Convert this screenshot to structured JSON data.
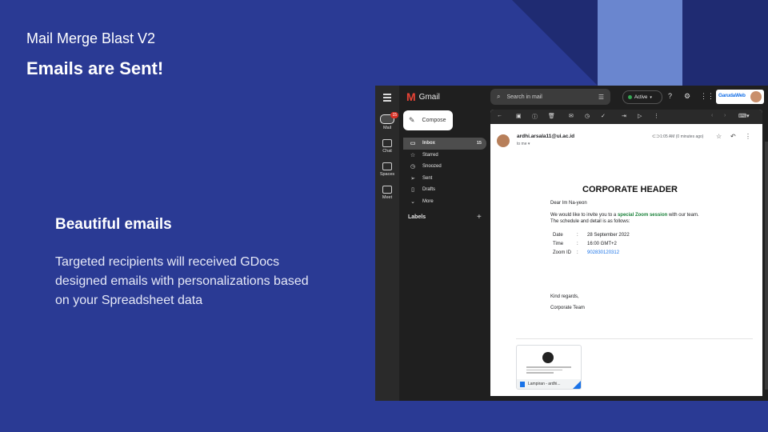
{
  "slide": {
    "subtitle": "Mail Merge Blast V2",
    "title": "Emails are Sent!",
    "feature_title": "Beautiful emails",
    "feature_desc": "Targeted recipients will received GDocs designed emails with personalizations based on your Spreadsheet data",
    "colors": {
      "background": "#2a3a94",
      "accent_light": "#6a86cf",
      "accent_dark": "#1f2b72"
    }
  },
  "gmail": {
    "logo_text": "Gmail",
    "search_placeholder": "Search in mail",
    "status": "Active",
    "brand_text": "GarudaWeb",
    "rail": [
      {
        "label": "Mail",
        "badge": "15",
        "icon": "mail-icon"
      },
      {
        "label": "Chat",
        "icon": "chat-icon"
      },
      {
        "label": "Spaces",
        "icon": "spaces-icon"
      },
      {
        "label": "Meet",
        "icon": "meet-icon"
      }
    ],
    "compose_label": "Compose",
    "nav": [
      {
        "label": "Inbox",
        "count": "15",
        "icon": "inbox-icon"
      },
      {
        "label": "Starred",
        "count": "",
        "icon": "star-icon"
      },
      {
        "label": "Snoozed",
        "count": "",
        "icon": "clock-icon"
      },
      {
        "label": "Sent",
        "count": "",
        "icon": "send-icon"
      },
      {
        "label": "Drafts",
        "count": "",
        "icon": "draft-icon"
      },
      {
        "label": "More",
        "count": "",
        "icon": "chevron-down-icon"
      }
    ],
    "labels_heading": "Labels",
    "email": {
      "sender": "ardhi.arsala11@ui.ac.id",
      "to": "to me",
      "time": "1:05 AM (0 minutes ago)",
      "header": "CORPORATE HEADER",
      "greeting": "Dear Im Na-yeon",
      "intro_before": "We would like to invite you to a ",
      "intro_highlight": "special Zoom session",
      "intro_after": " with our team.",
      "schedule_line": "The schedule and detail is as follows:",
      "details": [
        {
          "key": "Date",
          "value": "28 September 2022",
          "link": false
        },
        {
          "key": "Time",
          "value": "16:00 GMT+2",
          "link": false
        },
        {
          "key": "Zoom ID",
          "value": "902830120312",
          "link": true
        }
      ],
      "closing": "Kind regards,",
      "signature": "Corporate Team",
      "attachment_label": "Lampiran - ardhi..."
    }
  }
}
